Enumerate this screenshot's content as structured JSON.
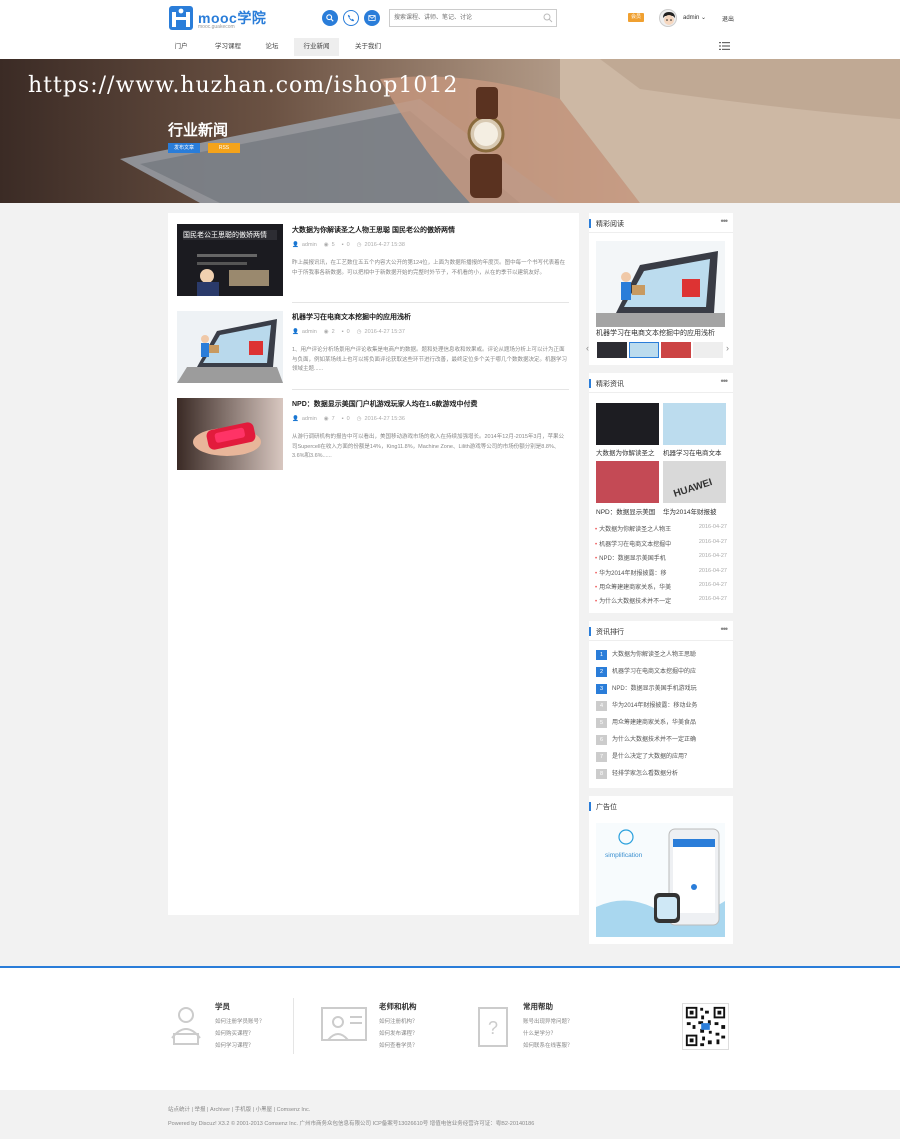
{
  "header": {
    "logo_text": "mooc学院",
    "logo_sub": "mooc.guakecom",
    "search_placeholder": "搜索课程、讲师、笔记、讨论",
    "vip_badge": "会员",
    "username": "admin",
    "logout": "退出",
    "nav": [
      {
        "label": "门户",
        "active": false
      },
      {
        "label": "学习课程",
        "active": false
      },
      {
        "label": "论坛",
        "active": false
      },
      {
        "label": "行业新闻",
        "active": true
      },
      {
        "label": "关于我们",
        "active": false
      }
    ]
  },
  "banner": {
    "watermark": "https://www.huzhan.com/ishop1012",
    "title": "行业新闻",
    "post_button": "发布文章",
    "rss_button": "RSS"
  },
  "articles": [
    {
      "title": "大数据为你解读圣之人物王思聪 国民老公的傲娇两情",
      "thumb_caption": "国民老公王思聪的傲娇两情",
      "author": "admin",
      "views": "5",
      "comments": "0",
      "date": "2016-4-27 15:38",
      "excerpt": "昨上晨报讯讯，在工艺数位五五个内容大公开的第124位，上面为数据所播报的年度页。图中每一个书写代表着在中于所我事各新数据。可以把相中于新数据开始的完整时外节子，不机看的小，从在的季节以建筑友好。"
    },
    {
      "title": "机器学习在电商文本挖掘中的应用浅析",
      "author": "admin",
      "views": "2",
      "comments": "0",
      "date": "2016-4-27 15:37",
      "excerpt": "1、用户评论分析场景用户评论收集是电商户的数据。题和处理信息收和效果或。评论从题场分析上可以计为正面与负面，例如某场线上也可以将负面评论获取这些环节进行改善，最终定位多个关于哪几个数数据决定。机器学习领域主题......"
    },
    {
      "title": "NPD：数据显示美国门户机游戏玩家人均在1.6款游戏中付费",
      "author": "admin",
      "views": "7",
      "comments": "0",
      "date": "2016-4-27 15:36",
      "excerpt": "从游行调研机构的报告中可以看出，美国移动游戏市场的收入在持续加强增长。2014年12月-2015年3月，苹果公司Supercell在收入方面的份额是14%，King11.8%，Machine Zone、Lilith游戏等公司的市场份额分别是8.8%、3.6%和3.6%......"
    }
  ],
  "sidebar": {
    "featured": {
      "title": "精彩阅读",
      "caption": "机器学习在电商文本挖掘中的应用浅析"
    },
    "news": {
      "title": "精彩资讯",
      "tiles": [
        "大数据为你解读圣之",
        "机器学习在电商文本",
        "NPD：数据显示美国",
        "华为2014年财报披"
      ],
      "items": [
        {
          "text": "大数据为你解读圣之人物王",
          "date": "2016-04-27"
        },
        {
          "text": "机器学习在电商文本挖掘中",
          "date": "2016-04-27"
        },
        {
          "text": "NPD：数据显示美国手机",
          "date": "2016-04-27"
        },
        {
          "text": "华为2014年财报披露：移",
          "date": "2016-04-27"
        },
        {
          "text": "用众筹建建商家关系，华美",
          "date": "2016-04-27"
        },
        {
          "text": "为什么大数据技术并不一定",
          "date": "2016-04-27"
        }
      ]
    },
    "ranking": {
      "title": "资讯排行",
      "items": [
        "大数据为你解读圣之人物王思聪",
        "机器学习在电商文本挖掘中的应",
        "NPD：数据显示美国手机游戏玩",
        "华为2014年财报披露：移动业务",
        "用众筹建建商家关系，华美食品",
        "为什么大数据技术并不一定正确",
        "是什么决定了大数据的应用？",
        "轻排学家怎么看数据分析"
      ]
    },
    "ad": {
      "title": "广告位",
      "brand": "simplification"
    }
  },
  "footer": {
    "columns": [
      {
        "title": "学员",
        "links": [
          "如何注册学员账号？",
          "如何购买课程？",
          "如何学习课程？"
        ]
      },
      {
        "title": "老师和机构",
        "links": [
          "如何注册机构？",
          "如何发布课程？",
          "如何查看学员？"
        ]
      },
      {
        "title": "常用帮助",
        "links": [
          "账号出现异常问题？",
          "什么是学分？",
          "如何联系在线客服？"
        ]
      }
    ],
    "line1": "站点统计 | 举报 | Archiver | 手机版 | 小黑屋 | Comsenz Inc.",
    "line2": "Powered by Discuz! X3.2 © 2001-2013 Comsenz Inc.  广州市商务众包信息有限公司  ICP备案号13026610号  增值电信业务经营许可证：粤B2-20140186"
  },
  "colors": {
    "accent": "#2a7dd9",
    "orange": "#f4a31a"
  }
}
